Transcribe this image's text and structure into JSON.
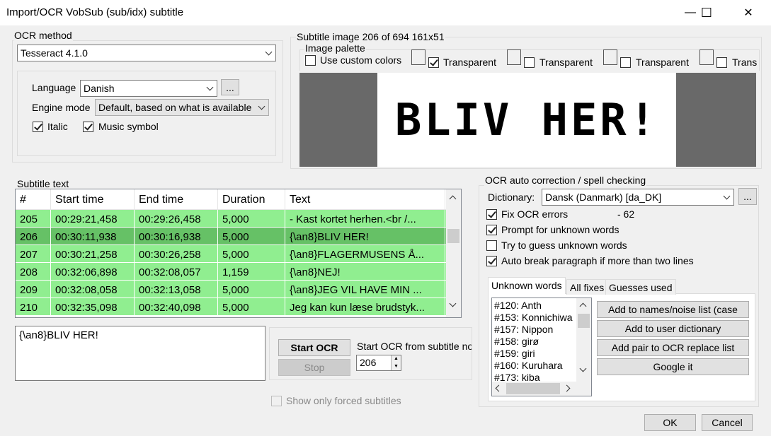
{
  "window": {
    "title": "Import/OCR VobSub (sub/idx) subtitle",
    "minimize_glyph": "—",
    "maximize_glyph": "☐",
    "close_glyph": "✕"
  },
  "ocr_method": {
    "group_label": "OCR method",
    "engine": "Tesseract 4.1.0",
    "language_label": "Language",
    "language": "Danish",
    "more_button": "...",
    "engine_mode_label": "Engine mode",
    "engine_mode": "Default, based on what is available",
    "italic_label": "Italic",
    "italic_checked": true,
    "music_label": "Music symbol",
    "music_checked": true
  },
  "subtitle_image": {
    "group_label": "Subtitle image 206 of 694   161x51",
    "palette_label": "Image palette",
    "use_custom_colors": "Use custom colors",
    "transparent_labels": [
      "Transparent",
      "Transparent",
      "Transparent",
      "Trans"
    ],
    "transparent_checked": [
      true,
      false,
      false,
      false
    ],
    "preview_text": "BLIV HER!"
  },
  "subtitle_text": {
    "group_label": "Subtitle text",
    "columns": [
      "#",
      "Start time",
      "End time",
      "Duration",
      "Text"
    ],
    "rows": [
      [
        "205",
        "00:29:21,458",
        "00:29:26,458",
        "5,000",
        "- Kast kortet herhen.<br /..."
      ],
      [
        "206",
        "00:30:11,938",
        "00:30:16,938",
        "5,000",
        "{\\an8}BLIV HER!"
      ],
      [
        "207",
        "00:30:21,258",
        "00:30:26,258",
        "5,000",
        "{\\an8}FLAGERMUSENS Å..."
      ],
      [
        "208",
        "00:32:06,898",
        "00:32:08,057",
        "1,159",
        "{\\an8}NEJ!"
      ],
      [
        "209",
        "00:32:08,058",
        "00:32:13,058",
        "5,000",
        "{\\an8}JEG VIL HAVE MIN ..."
      ],
      [
        "210",
        "00:32:35,098",
        "00:32:40,098",
        "5,000",
        "Jeg kan kun læse brudstyk..."
      ]
    ],
    "selected_index": 1,
    "current_text": "{\\an8}BLIV HER!"
  },
  "ocr_controls": {
    "start_ocr": "Start OCR",
    "stop": "Stop",
    "start_from_label": "Start OCR from subtitle no",
    "start_from_value": "206",
    "show_forced_label": "Show only forced subtitles"
  },
  "auto_correction": {
    "group_label": "OCR auto correction / spell checking",
    "dictionary_label": "Dictionary:",
    "dictionary": "Dansk (Danmark) [da_DK]",
    "more_button": "...",
    "fix_ocr_label": "Fix OCR errors",
    "fix_ocr_count": "- 62",
    "fix_ocr_checked": true,
    "prompt_label": "Prompt for unknown words",
    "prompt_checked": true,
    "guess_label": "Try to guess unknown words",
    "guess_checked": false,
    "autobreak_label": "Auto break paragraph if more than two lines",
    "autobreak_checked": true,
    "tabs": [
      "Unknown words",
      "All fixes",
      "Guesses used"
    ],
    "active_tab": 0,
    "unknown_words": [
      "#120: Anth",
      "#153: Konnichiwa",
      "#157: Nippon",
      "#158: girø",
      "#159: giri",
      "#160: Kuruhara",
      "#173: kiba"
    ],
    "buttons": [
      "Add to names/noise list (case",
      "Add to user dictionary",
      "Add pair to OCR replace list",
      "Google it"
    ]
  },
  "footer": {
    "ok": "OK",
    "cancel": "Cancel"
  }
}
